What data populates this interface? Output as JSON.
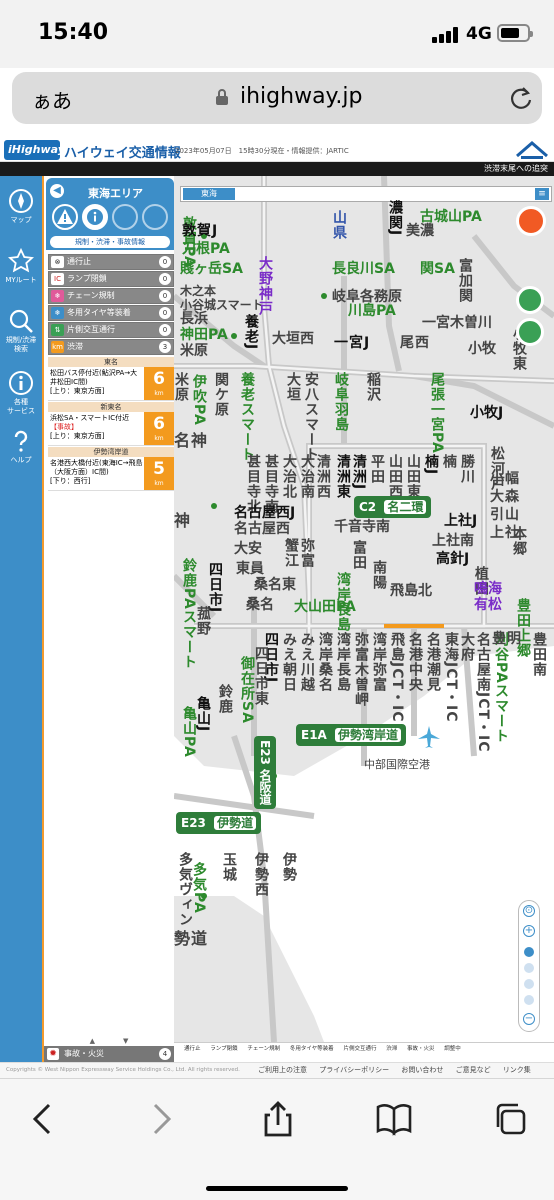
{
  "status": {
    "time": "15:40",
    "network": "4G"
  },
  "browser": {
    "text_size": "ぁあ",
    "url": "ihighway.jp"
  },
  "site": {
    "logo": "iHighway",
    "title": "ハイウェイ交通情報",
    "stamp": "2023年05月07日　15時30分現在・情報提供：JARTIC",
    "ticker": "渋滞末尾への追突"
  },
  "sidenav": [
    {
      "label": "マップ",
      "icon": "compass-icon"
    },
    {
      "label": "MYルート",
      "icon": "star-icon"
    },
    {
      "label": "規制/渋滞\n検索",
      "icon": "search-icon"
    },
    {
      "label": "各種\nサービス",
      "icon": "info-icon"
    },
    {
      "label": "ヘルプ",
      "icon": "help-icon"
    }
  ],
  "panel": {
    "title": "東海エリア",
    "tab": "規制・渋滞・事故情報",
    "legend": [
      {
        "label": "通行止",
        "icon": "⊗",
        "count": "0"
      },
      {
        "label": "ランプ閉鎖",
        "icon": "IC",
        "count": "0"
      },
      {
        "label": "チェーン規制",
        "icon": "❄",
        "count": "0"
      },
      {
        "label": "冬用タイヤ等装着",
        "icon": "❄",
        "count": "0"
      },
      {
        "label": "片側交互通行",
        "icon": "⇅",
        "count": "0"
      },
      {
        "label": "渋滞",
        "icon": "km",
        "count": "3"
      }
    ],
    "sections": [
      {
        "name": "東名",
        "entries": [
          {
            "line1": "松田バス停付近(鮎沢PA→大井松田IC間)",
            "line2": "",
            "dir": "[上り：東京方面]",
            "km": "6"
          }
        ]
      },
      {
        "name": "新東名",
        "entries": [
          {
            "line1": "浜松SA・スマートIC付近",
            "line2": "【事故】",
            "dir": "[上り：東京方面]",
            "km": "6"
          }
        ]
      },
      {
        "name": "伊勢湾岸道",
        "entries": [
          {
            "line1": "名港西大橋付近(東海IC→飛島（大阪方面）IC間)",
            "line2": "",
            "dir": "[下り：西行]",
            "km": "5"
          }
        ]
      }
    ],
    "km_unit": "km",
    "scroll": "▲　　　　▼",
    "accident": {
      "label": "事故・火災",
      "count": "4"
    }
  },
  "map": {
    "tab": "東海",
    "legend": [
      "通行止",
      "ランプ閉鎖",
      "チェーン規制",
      "冬用タイヤ等装着",
      "片側交互通行",
      "渋滞",
      "事故・火災",
      "調整中"
    ]
  },
  "footer": {
    "copyright": "Copyrights © West Nippon Expressway Service Holdings Co., Ltd.  All rights reserved.",
    "links": [
      "ご利用上の注意",
      "プライバシーポリシー",
      "お問い合わせ",
      "ご意見など",
      "リンク集"
    ]
  }
}
